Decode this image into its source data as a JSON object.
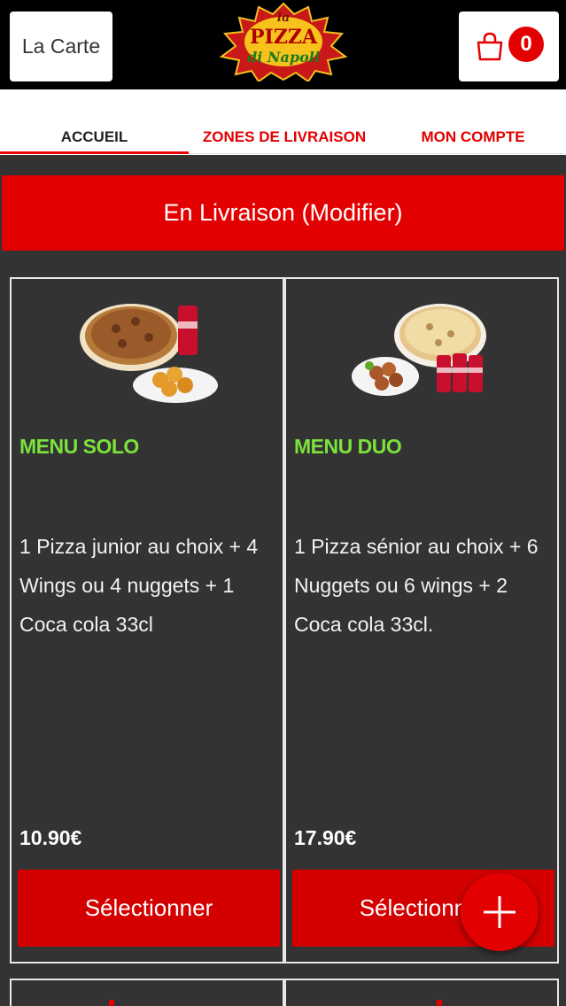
{
  "header": {
    "menu_button": "La Carte",
    "logo_alt": "La Pizza di Napoli",
    "cart_count": "0"
  },
  "tabs": [
    {
      "label": "ACCUEIL",
      "active": true
    },
    {
      "label": "ZONES DE LIVRAISON",
      "active": false
    },
    {
      "label": "MON COMPTE",
      "active": false
    }
  ],
  "delivery_banner": "En Livraison (Modifier)",
  "products": [
    {
      "title": "MENU SOLO",
      "description": "1 Pizza junior au choix  + 4 Wings ou 4 nuggets  + 1 Coca cola 33cl",
      "price": "10.90€",
      "button": "Sélectionner"
    },
    {
      "title": "MENU DUO",
      "description": "1 Pizza sénior au choix  + 6 Nuggets ou 6 wings  + 2 Coca cola 33cl.",
      "price": "17.90€",
      "button": "Sélectionner"
    }
  ],
  "colors": {
    "accent": "#e30000",
    "title_green": "#7be33b",
    "background_dark": "#333333"
  },
  "icons": [
    "shopping-bag-icon",
    "plus-icon"
  ]
}
